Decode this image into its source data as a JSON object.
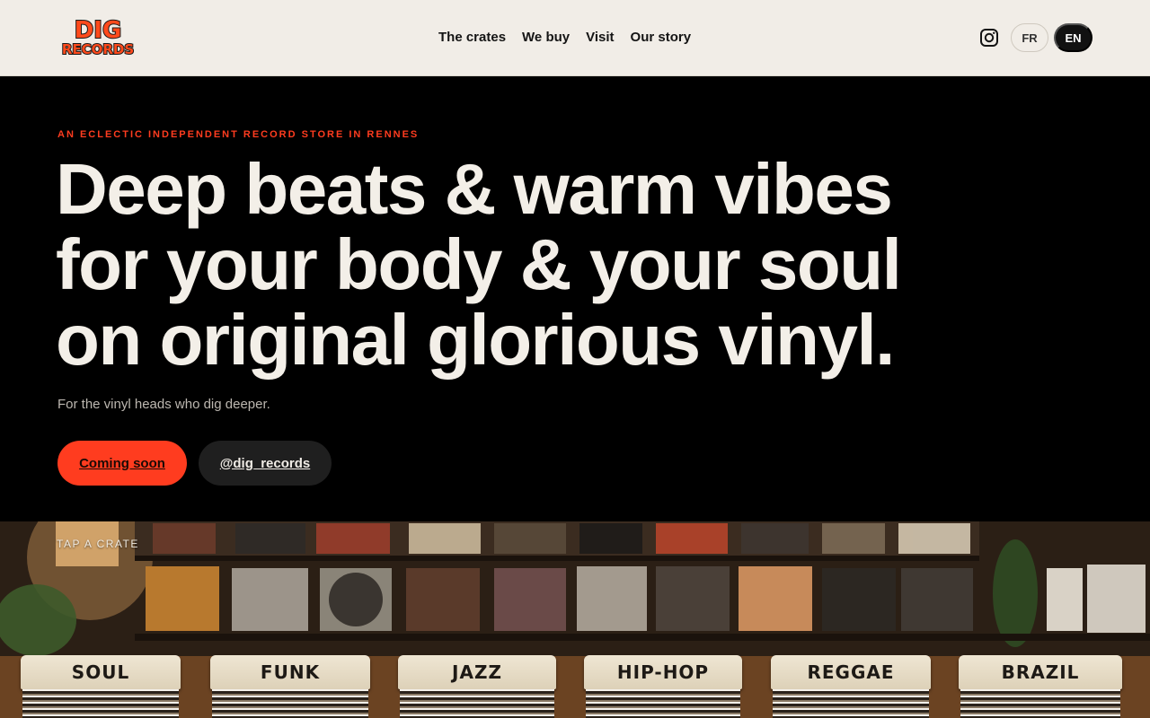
{
  "brand": {
    "logo_alt": "DIG RECORDS",
    "logo_line1": "DIG",
    "logo_line2": "RECORDS",
    "colors": {
      "accent": "#ff3c1f",
      "header_bg": "#f1ede7",
      "hero_bg": "#000000",
      "text_light": "#f3efe8"
    }
  },
  "nav": {
    "items": [
      {
        "label": "The crates"
      },
      {
        "label": "We buy"
      },
      {
        "label": "Visit"
      },
      {
        "label": "Our story"
      }
    ]
  },
  "header": {
    "instagram_icon": "instagram-icon",
    "languages": [
      {
        "label": "FR",
        "active": false
      },
      {
        "label": "EN",
        "active": true
      }
    ]
  },
  "hero": {
    "eyebrow": "AN ECLECTIC INDEPENDENT RECORD STORE IN RENNES",
    "headline_lines": [
      "Deep beats & warm vibes",
      "for your body & your soul",
      "on original glorious vinyl."
    ],
    "subtitle": "For the vinyl heads who dig deeper.",
    "primary_button": "Coming soon",
    "secondary_button": "@dig_records"
  },
  "crates": {
    "tap_label": "TAP A CRATE",
    "items": [
      {
        "label": "SOUL"
      },
      {
        "label": "FUNK"
      },
      {
        "label": "JAZZ"
      },
      {
        "label": "HIP-HOP"
      },
      {
        "label": "REGGAE"
      },
      {
        "label": "BRAZIL"
      }
    ]
  }
}
